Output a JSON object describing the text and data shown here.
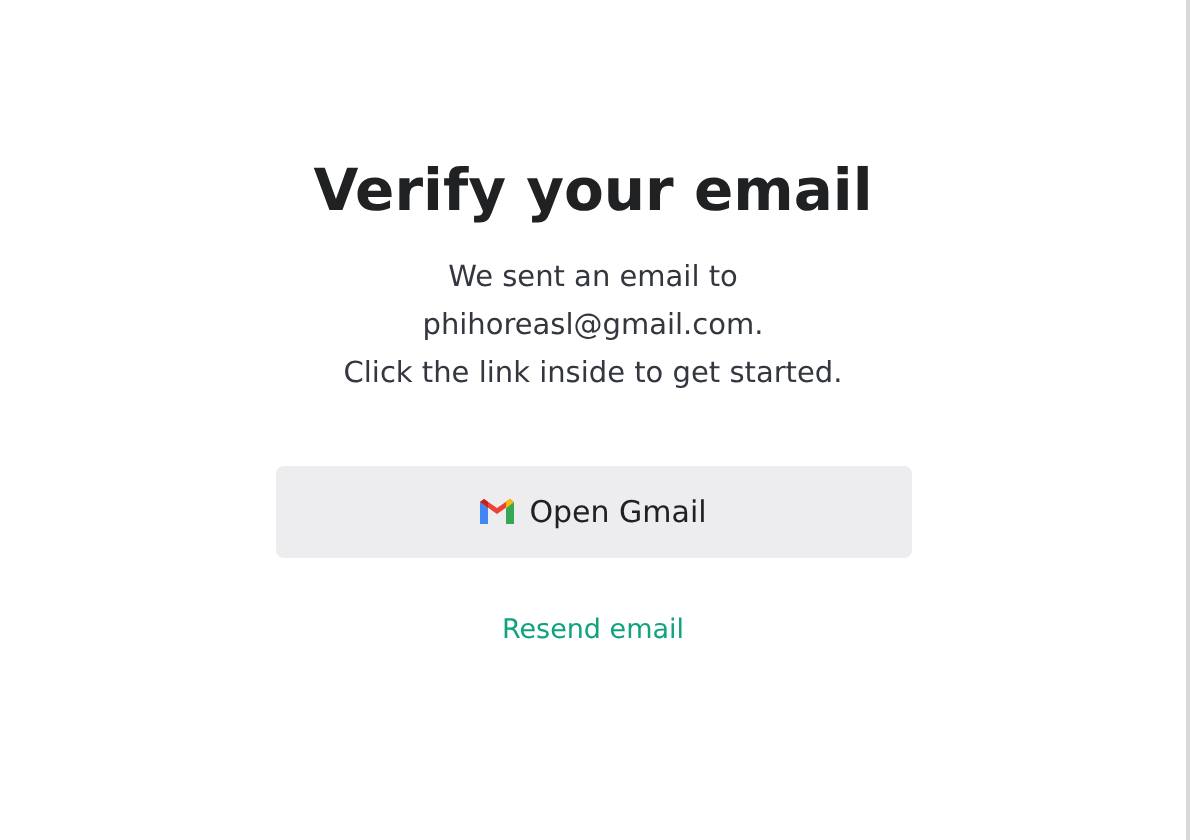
{
  "title": "Verify your email",
  "message_lines": [
    "We sent an email to",
    "phihoreasl@gmail.com.",
    "Click the link inside to get started."
  ],
  "open_button": {
    "label": "Open Gmail"
  },
  "resend_link": {
    "label": "Resend email"
  }
}
